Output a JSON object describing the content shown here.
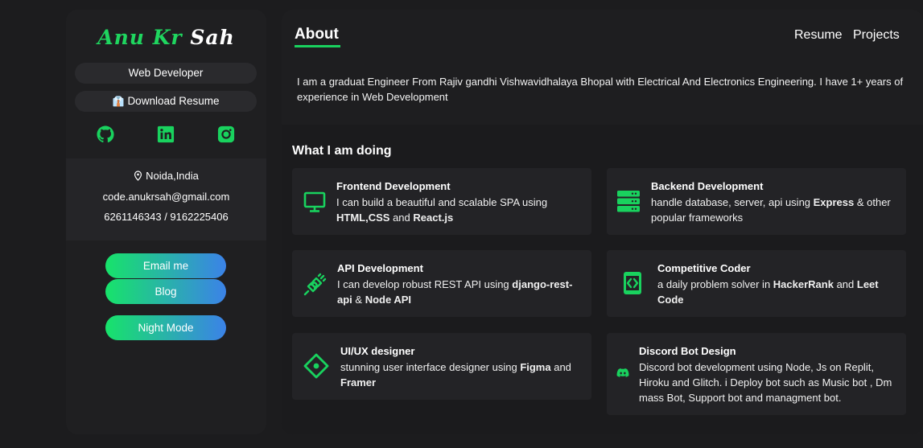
{
  "sidebar": {
    "name_first": "Anu Kr",
    "name_last": "Sah",
    "role": "Web Developer",
    "download_resume": "Download Resume",
    "socials": [
      "github-icon",
      "linkedin-icon",
      "instagram-icon"
    ],
    "location": "Noida,India",
    "email": "code.anukrsah@gmail.com",
    "phone": "6261146343 / 9162225406",
    "buttons": {
      "email_me": "Email me",
      "blog": "Blog",
      "night_mode": "Night Mode"
    }
  },
  "main": {
    "about_title": "About",
    "nav": {
      "resume": "Resume",
      "projects": "Projects"
    },
    "about_text": "I am a graduat Engineer From Rajiv gandhi Vishwavidhalaya Bhopal with Electrical And Electronics Engineering. I have 1+ years of experience in Web Development",
    "doing_title": "What I am doing",
    "services": [
      {
        "icon": "monitor-icon",
        "title": "Frontend Development",
        "desc_parts": [
          {
            "t": "I can build a beautiful and scalable SPA using ",
            "b": false
          },
          {
            "t": "HTML,CSS",
            "b": true
          },
          {
            "t": " and ",
            "b": false
          },
          {
            "t": "React.js",
            "b": true
          }
        ]
      },
      {
        "icon": "server-icon",
        "title": "Backend Development",
        "desc_parts": [
          {
            "t": "handle database, server, api using ",
            "b": false
          },
          {
            "t": "Express",
            "b": true
          },
          {
            "t": " & other popular frameworks",
            "b": false
          }
        ]
      },
      {
        "icon": "plug-icon",
        "title": "API Development",
        "desc_parts": [
          {
            "t": "I can develop robust REST API using ",
            "b": false
          },
          {
            "t": "django-rest-api",
            "b": true
          },
          {
            "t": " & ",
            "b": false
          },
          {
            "t": "Node API",
            "b": true
          }
        ]
      },
      {
        "icon": "code-icon",
        "title": "Competitive Coder",
        "desc_parts": [
          {
            "t": "a daily problem solver in ",
            "b": false
          },
          {
            "t": "HackerRank",
            "b": true
          },
          {
            "t": " and ",
            "b": false
          },
          {
            "t": "Leet Code",
            "b": true
          }
        ]
      },
      {
        "icon": "design-icon",
        "title": "UI/UX designer",
        "desc_parts": [
          {
            "t": "stunning user interface designer using ",
            "b": false
          },
          {
            "t": "Figma",
            "b": true
          },
          {
            "t": " and ",
            "b": false
          },
          {
            "t": "Framer",
            "b": true
          }
        ]
      },
      {
        "icon": "discord-icon",
        "title": "Discord Bot Design",
        "desc_parts": [
          {
            "t": "Discord bot development using Node, Js on Replit, Hiroku and Glitch. i Deploy bot such as Music bot , Dm mass Bot, Support bot and managment bot.",
            "b": false
          }
        ]
      }
    ]
  },
  "colors": {
    "accent": "#19d25e",
    "gradient_start": "#17e36a",
    "gradient_end": "#3b82e8",
    "background": "#1c1c1e",
    "card": "#232326"
  }
}
